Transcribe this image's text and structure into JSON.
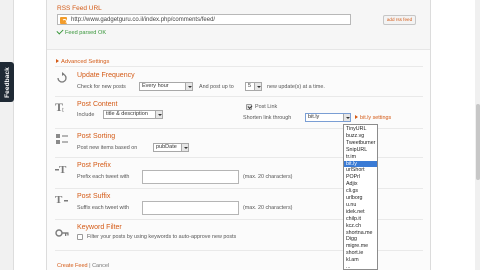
{
  "feedback_tab": {
    "label": "Feedback"
  },
  "rss": {
    "label": "RSS Feed URL",
    "url": "http://www.gadgetguru.co.il/index.php/comments/feed/",
    "add_button": "add rss feed",
    "parsed_ok": "Feed parsed OK"
  },
  "advanced": {
    "label": "Advanced Settings"
  },
  "update_frequency": {
    "title": "Update Frequency",
    "check_label": "Check for new posts",
    "frequency_value": "Every hour",
    "post_up_to_label": "And post up to",
    "count_value": "5",
    "count_suffix": "new update(s) at a time."
  },
  "post_content": {
    "title": "Post Content",
    "include_label": "Include",
    "include_value": "title & description",
    "post_link_label": "Post Link",
    "shorten_label": "Shorten link through",
    "shorten_value": "bit.ly",
    "settings_link": "bit.ly settings"
  },
  "post_sorting": {
    "title": "Post Sorting",
    "label": "Post new items based on",
    "value": "pubDate"
  },
  "post_prefix": {
    "title": "Post Prefix",
    "label": "Prefix each tweet with",
    "hint": "(max. 20 characters)"
  },
  "post_suffix": {
    "title": "Post Suffix",
    "label": "Suffix each tweet with",
    "hint": "(max. 20 characters)"
  },
  "keyword_filter": {
    "title": "Keyword Filter",
    "label": "Filter your posts by using keywords to auto-approve new posts"
  },
  "shortener_options": [
    "TinyURL",
    "buzz.vg",
    "Tweetburner",
    "SnipURL",
    "tr.im",
    "bit.ly",
    "urlShort",
    "POPrl",
    "Adjix",
    "cli.gs",
    "urlborg",
    "u.nu",
    "idek.net",
    "chilp.it",
    "kcz.ch",
    "shortna.me",
    "Digg",
    "migre.me",
    "short.ie",
    "kl.am",
    "..."
  ],
  "shortener_selected_index": 5,
  "actions": {
    "create": "Create Feed",
    "cancel": "Cancel"
  },
  "colors": {
    "accent": "#d45a16",
    "ok_green": "#379639",
    "selection": "#3a7bd5"
  }
}
